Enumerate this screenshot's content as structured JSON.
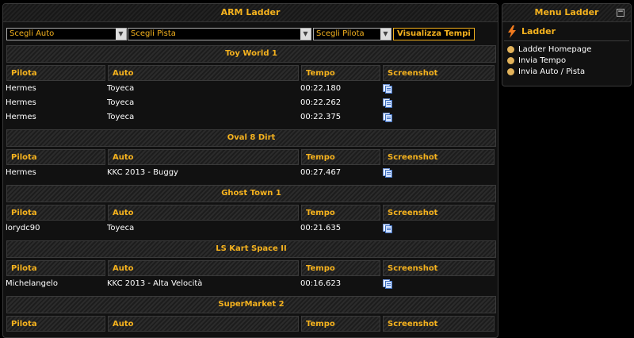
{
  "main": {
    "title": "ARM Ladder",
    "filters": {
      "auto_label": "Scegli Auto",
      "pista_label": "Scegli Pista",
      "pilota_label": "Scegli Pilota",
      "show_button": "Visualizza Tempi"
    },
    "columns": {
      "pilota": "Pilota",
      "auto": "Auto",
      "tempo": "Tempo",
      "screenshot": "Screenshot"
    },
    "tracks": [
      {
        "name": "Toy World 1",
        "rows": [
          {
            "pilota": "Hermes",
            "auto": "Toyeca",
            "tempo": "00:22.180"
          },
          {
            "pilota": "Hermes",
            "auto": "Toyeca",
            "tempo": "00:22.262"
          },
          {
            "pilota": "Hermes",
            "auto": "Toyeca",
            "tempo": "00:22.375"
          }
        ]
      },
      {
        "name": "Oval 8 Dirt",
        "rows": [
          {
            "pilota": "Hermes",
            "auto": "KKC 2013 - Buggy",
            "tempo": "00:27.467"
          }
        ]
      },
      {
        "name": "Ghost Town 1",
        "rows": [
          {
            "pilota": "lorydc90",
            "auto": "Toyeca",
            "tempo": "00:21.635"
          }
        ]
      },
      {
        "name": "LS Kart Space II",
        "rows": [
          {
            "pilota": "Michelangelo",
            "auto": "KKC 2013 - Alta Velocità",
            "tempo": "00:16.623"
          }
        ]
      },
      {
        "name": "SuperMarket 2",
        "rows": []
      }
    ]
  },
  "side": {
    "title": "Menu Ladder",
    "collapse_icon": "minus-icon",
    "section": "Ladder",
    "items": [
      "Ladder Homepage",
      "Invia Tempo",
      "Invia Auto / Pista"
    ]
  },
  "colors": {
    "accent": "#f5b21e",
    "background": "#000000"
  }
}
